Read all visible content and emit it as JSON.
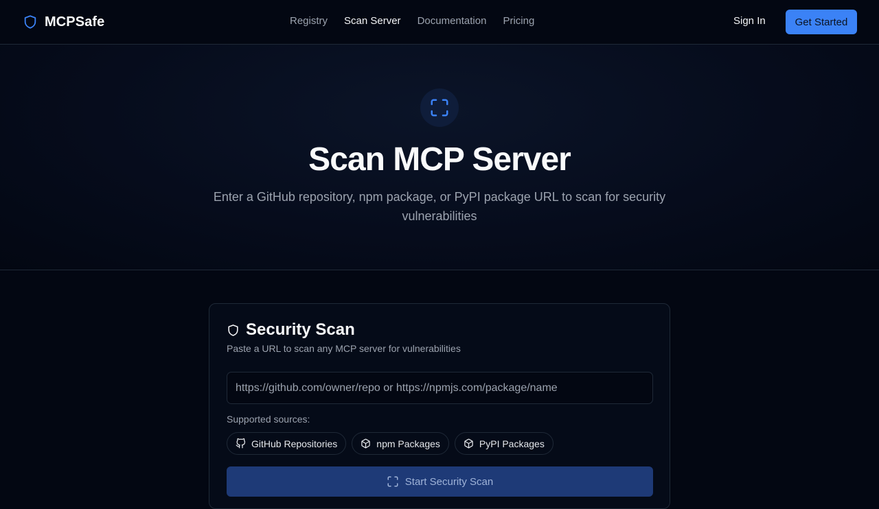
{
  "navbar": {
    "brand": "MCPSafe",
    "links": [
      {
        "label": "Registry",
        "active": false
      },
      {
        "label": "Scan Server",
        "active": true
      },
      {
        "label": "Documentation",
        "active": false
      },
      {
        "label": "Pricing",
        "active": false
      }
    ],
    "sign_in": "Sign In",
    "get_started": "Get Started"
  },
  "hero": {
    "icon": "scan-icon",
    "title": "Scan MCP Server",
    "subtitle": "Enter a GitHub repository, npm package, or PyPI package URL to scan for security vulnerabilities"
  },
  "scan_card": {
    "icon": "shield-icon",
    "title": "Security Scan",
    "subtitle": "Paste a URL to scan any MCP server for vulnerabilities",
    "url_input": {
      "value": "",
      "placeholder": "https://github.com/owner/repo or https://npmjs.com/package/name"
    },
    "sources_label": "Supported sources:",
    "sources": [
      {
        "label": "GitHub Repositories",
        "icon": "github-icon"
      },
      {
        "label": "npm Packages",
        "icon": "package-icon"
      },
      {
        "label": "PyPI Packages",
        "icon": "package-icon"
      }
    ],
    "scan_button": "Start Security Scan"
  },
  "colors": {
    "background": "#030712",
    "accent": "#3b82f6",
    "border": "#1f2937",
    "muted_text": "#9ca3af",
    "scan_button_bg": "#1e3a77"
  }
}
